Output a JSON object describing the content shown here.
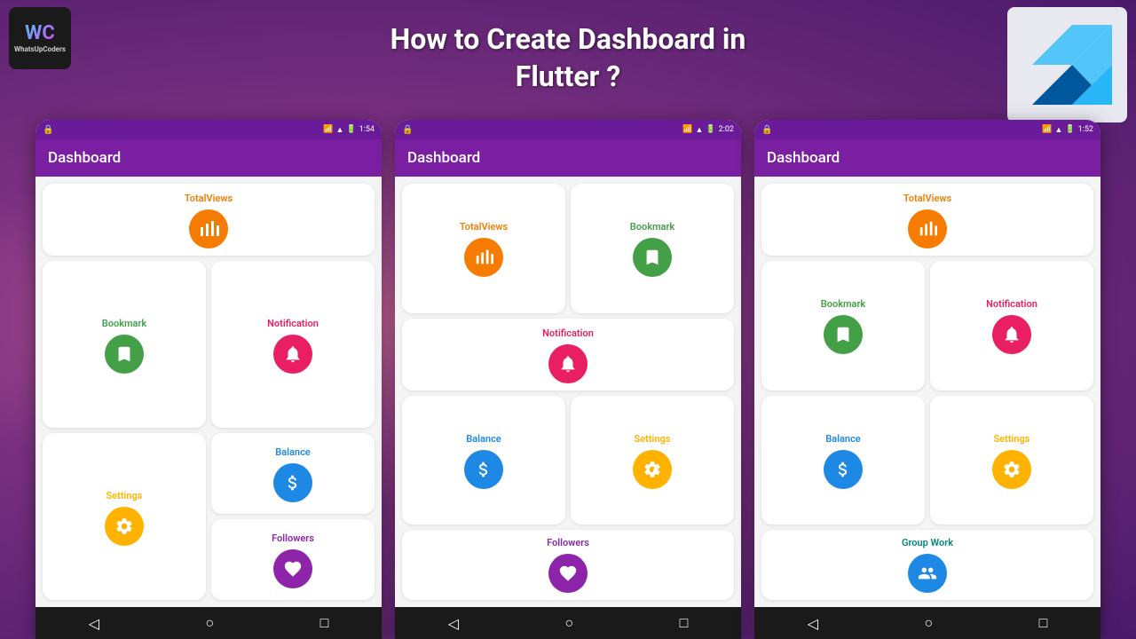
{
  "page": {
    "title_line1": "How to Create Dashboard in",
    "title_line2": "Flutter ?"
  },
  "logo": {
    "wc": "WC",
    "name": "WhatsUpCoders"
  },
  "phones": [
    {
      "id": "phone1",
      "status_time": "1:54",
      "app_title": "Dashboard",
      "cards": [
        {
          "id": "total-views",
          "title": "TotalViews",
          "title_color": "color-orange",
          "icon": "▌▌",
          "bg": "orange",
          "layout": "full"
        },
        {
          "id": "bookmark",
          "title": "Bookmark",
          "title_color": "color-green",
          "icon": "🔖",
          "bg": "green",
          "layout": "half-left"
        },
        {
          "id": "notification",
          "title": "Notification",
          "title_color": "color-pink",
          "icon": "🔔",
          "bg": "pink",
          "layout": "half-right"
        },
        {
          "id": "balance",
          "title": "Balance",
          "title_color": "color-blue",
          "icon": "$",
          "bg": "blue",
          "layout": "half-right-2"
        },
        {
          "id": "settings",
          "title": "Settings",
          "title_color": "color-yellow",
          "icon": "⚙",
          "bg": "yellow",
          "layout": "half-left-2"
        },
        {
          "id": "followers",
          "title": "Followers",
          "title_color": "color-purple",
          "icon": "♥",
          "bg": "purple",
          "layout": "half-right-3"
        }
      ]
    },
    {
      "id": "phone2",
      "status_time": "2:02",
      "app_title": "Dashboard",
      "cards": [
        {
          "id": "total-views",
          "title": "TotalViews",
          "title_color": "color-orange",
          "icon": "▌▌",
          "bg": "orange",
          "layout": "full"
        },
        {
          "id": "bookmark",
          "title": "Bookmark",
          "title_color": "color-green",
          "icon": "🔖",
          "bg": "green",
          "layout": "full"
        },
        {
          "id": "notification",
          "title": "Notification",
          "title_color": "color-pink",
          "icon": "🔔",
          "bg": "pink",
          "layout": "full"
        },
        {
          "id": "balance",
          "title": "Balance",
          "title_color": "color-blue",
          "icon": "$",
          "bg": "blue",
          "layout": "half"
        },
        {
          "id": "settings",
          "title": "Settings",
          "title_color": "color-yellow",
          "icon": "⚙",
          "bg": "yellow",
          "layout": "half"
        },
        {
          "id": "followers",
          "title": "Followers",
          "title_color": "color-purple",
          "icon": "♥",
          "bg": "purple",
          "layout": "partial"
        }
      ]
    },
    {
      "id": "phone3",
      "status_time": "1:52",
      "app_title": "Dashboard",
      "cards": [
        {
          "id": "total-views",
          "title": "TotalViews",
          "title_color": "color-orange",
          "icon": "▌▌",
          "bg": "orange",
          "layout": "full"
        },
        {
          "id": "bookmark",
          "title": "Bookmark",
          "title_color": "color-green",
          "icon": "🔖",
          "bg": "green",
          "layout": "grid"
        },
        {
          "id": "notification",
          "title": "Notification",
          "title_color": "color-pink",
          "icon": "🔔",
          "bg": "pink",
          "layout": "grid"
        },
        {
          "id": "balance",
          "title": "Balance",
          "title_color": "color-blue",
          "icon": "$",
          "bg": "blue",
          "layout": "grid"
        },
        {
          "id": "settings",
          "title": "Settings",
          "title_color": "color-yellow",
          "icon": "⚙",
          "bg": "yellow",
          "layout": "grid"
        },
        {
          "id": "group-work",
          "title": "Group Work",
          "title_color": "color-teal",
          "icon": "👥",
          "bg": "blue",
          "layout": "partial"
        }
      ]
    }
  ],
  "nav": {
    "back": "◁",
    "home": "○",
    "recent": "□"
  }
}
